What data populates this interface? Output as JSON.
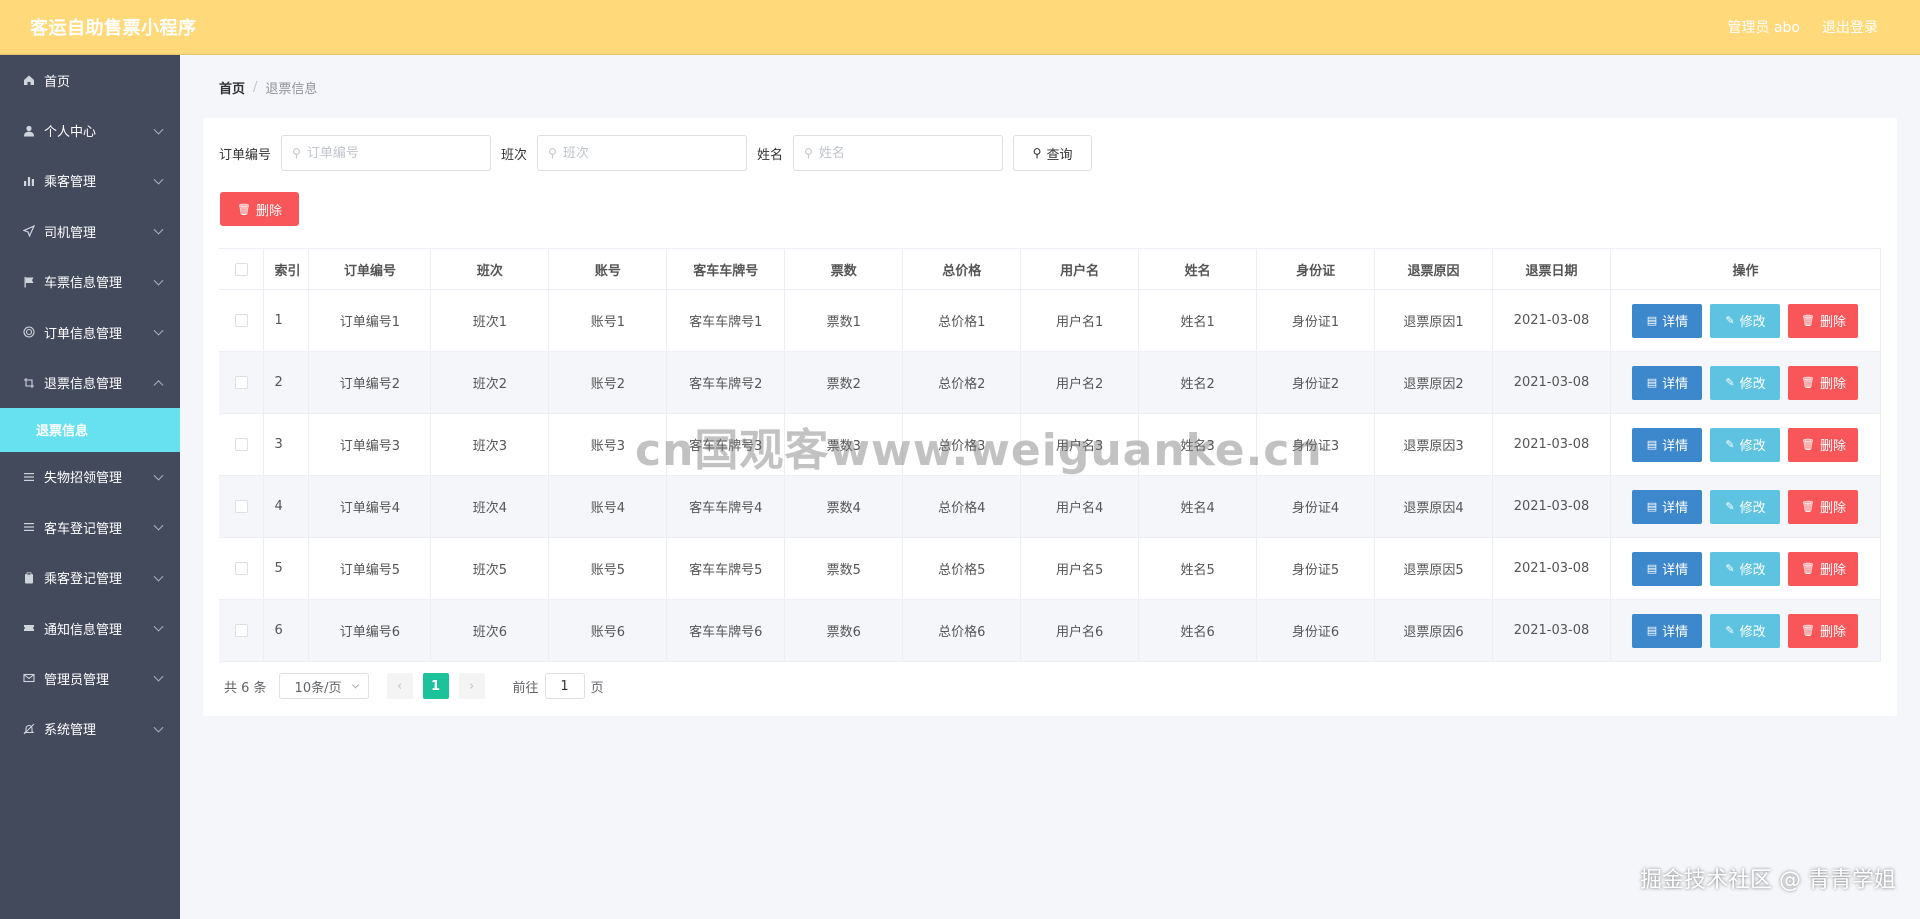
{
  "header": {
    "title": "客运自助售票小程序",
    "admin_label": "管理员 abo",
    "logout_label": "退出登录"
  },
  "sidebar": {
    "items": [
      {
        "label": "首页",
        "icon": "home-icon"
      },
      {
        "label": "个人中心",
        "icon": "user-icon"
      },
      {
        "label": "乘客管理",
        "icon": "bar-chart-icon"
      },
      {
        "label": "司机管理",
        "icon": "send-icon"
      },
      {
        "label": "车票信息管理",
        "icon": "flag-icon"
      },
      {
        "label": "订单信息管理",
        "icon": "target-icon"
      },
      {
        "label": "退票信息管理",
        "icon": "crop-icon"
      },
      {
        "label": "失物招领管理",
        "icon": "list-icon"
      },
      {
        "label": "客车登记管理",
        "icon": "list-icon"
      },
      {
        "label": "乘客登记管理",
        "icon": "clipboard-icon"
      },
      {
        "label": "通知信息管理",
        "icon": "ticket-icon"
      },
      {
        "label": "管理员管理",
        "icon": "mail-icon"
      },
      {
        "label": "系统管理",
        "icon": "bell-off-icon"
      }
    ],
    "active_sub": "退票信息"
  },
  "breadcrumb": {
    "home": "首页",
    "separator": "/",
    "current": "退票信息"
  },
  "search": {
    "order_label": "订单编号",
    "order_placeholder": "订单编号",
    "shift_label": "班次",
    "shift_placeholder": "班次",
    "name_label": "姓名",
    "name_placeholder": "姓名",
    "query_label": "查询"
  },
  "actions": {
    "delete_label": "删除"
  },
  "table": {
    "headers": [
      "索引",
      "订单编号",
      "班次",
      "账号",
      "客车车牌号",
      "票数",
      "总价格",
      "用户名",
      "姓名",
      "身份证",
      "退票原因",
      "退票日期",
      "操作"
    ],
    "rows": [
      [
        "1",
        "订单编号1",
        "班次1",
        "账号1",
        "客车车牌号1",
        "票数1",
        "总价格1",
        "用户名1",
        "姓名1",
        "身份证1",
        "退票原因1",
        "2021-03-08"
      ],
      [
        "2",
        "订单编号2",
        "班次2",
        "账号2",
        "客车车牌号2",
        "票数2",
        "总价格2",
        "用户名2",
        "姓名2",
        "身份证2",
        "退票原因2",
        "2021-03-08"
      ],
      [
        "3",
        "订单编号3",
        "班次3",
        "账号3",
        "客车车牌号3",
        "票数3",
        "总价格3",
        "用户名3",
        "姓名3",
        "身份证3",
        "退票原因3",
        "2021-03-08"
      ],
      [
        "4",
        "订单编号4",
        "班次4",
        "账号4",
        "客车车牌号4",
        "票数4",
        "总价格4",
        "用户名4",
        "姓名4",
        "身份证4",
        "退票原因4",
        "2021-03-08"
      ],
      [
        "5",
        "订单编号5",
        "班次5",
        "账号5",
        "客车车牌号5",
        "票数5",
        "总价格5",
        "用户名5",
        "姓名5",
        "身份证5",
        "退票原因5",
        "2021-03-08"
      ],
      [
        "6",
        "订单编号6",
        "班次6",
        "账号6",
        "客车车牌号6",
        "票数6",
        "总价格6",
        "用户名6",
        "姓名6",
        "身份证6",
        "退票原因6",
        "2021-03-08"
      ]
    ],
    "op_detail": "详情",
    "op_edit": "修改",
    "op_delete": "删除"
  },
  "pagination": {
    "total": "共 6 条",
    "page_size": "10条/页",
    "current_page": "1",
    "goto_label": "前往",
    "goto_value": "1",
    "page_suffix": "页"
  },
  "watermarks": {
    "center": "cn国观客www.weiguanke.cn",
    "corner": "掘金技术社区 @ 青青学姐"
  },
  "colors": {
    "header_bg": "#ffd97a",
    "sidebar_bg": "#434a5c",
    "sidebar_active": "#67e0f0",
    "danger": "#f9565a",
    "primary": "#3d87cc",
    "info": "#5ec3e0",
    "pager_active": "#1bc29a"
  }
}
